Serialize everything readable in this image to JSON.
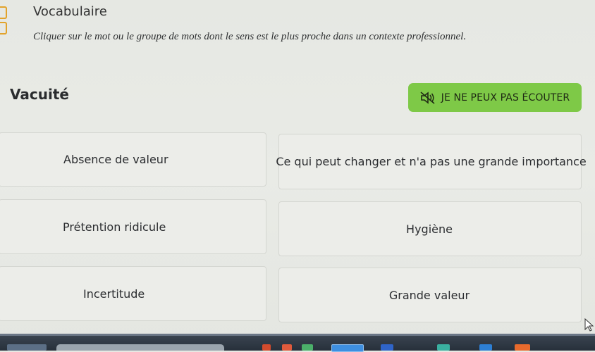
{
  "header": {
    "section_title": "Vocabulaire",
    "instruction": "Cliquer sur le mot ou le groupe de mots dont le sens est le plus proche dans un contexte professionnel."
  },
  "question": {
    "word": "Vacuité"
  },
  "listen_button": {
    "label": "JE NE PEUX PAS ÉCOUTER",
    "icon": "speaker-muted-icon",
    "color": "#7ec947"
  },
  "options": [
    "Absence de valeur",
    "Ce qui peut changer et n'a pas une grande importance",
    "Prétention ridicule",
    "Hygiène",
    "Incertitude",
    "Grande valeur"
  ],
  "colors": {
    "accent": "#7ec947",
    "logo": "#e2a32b"
  }
}
